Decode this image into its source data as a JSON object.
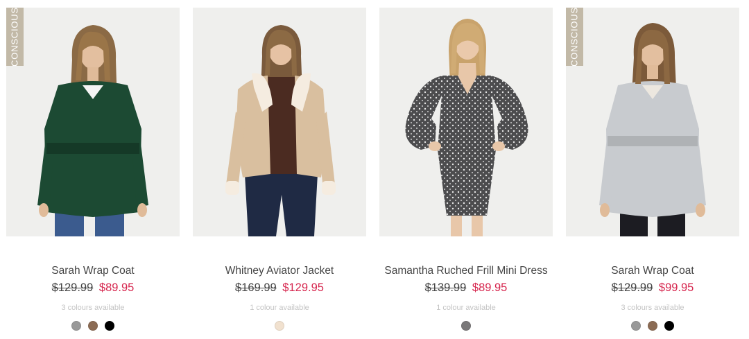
{
  "products": [
    {
      "badge": "CONSCIOUS",
      "name": "Sarah Wrap Coat",
      "price_old": "$129.99",
      "price_new": "$89.95",
      "colours_text": "3 colours available",
      "swatches": [
        "#999999",
        "#8b6b54",
        "#000000"
      ],
      "garment_color": "#1c4a33"
    },
    {
      "badge": "",
      "name": "Whitney Aviator Jacket",
      "price_old": "$169.99",
      "price_new": "$129.95",
      "colours_text": "1 colour available",
      "swatches": [
        "#f1e1cf"
      ],
      "garment_color": "#d9bf9f"
    },
    {
      "badge": "",
      "name": "Samantha Ruched Frill Mini Dress",
      "price_old": "$139.99",
      "price_new": "$89.95",
      "colours_text": "1 colour available",
      "swatches": [
        "#7a7879"
      ],
      "garment_color": "#4c4c4e"
    },
    {
      "badge": "CONSCIOUS",
      "name": "Sarah Wrap Coat",
      "price_old": "$129.99",
      "price_new": "$99.95",
      "colours_text": "3 colours available",
      "swatches": [
        "#999999",
        "#8b6b54",
        "#000000"
      ],
      "garment_color": "#c8cbcf"
    }
  ]
}
